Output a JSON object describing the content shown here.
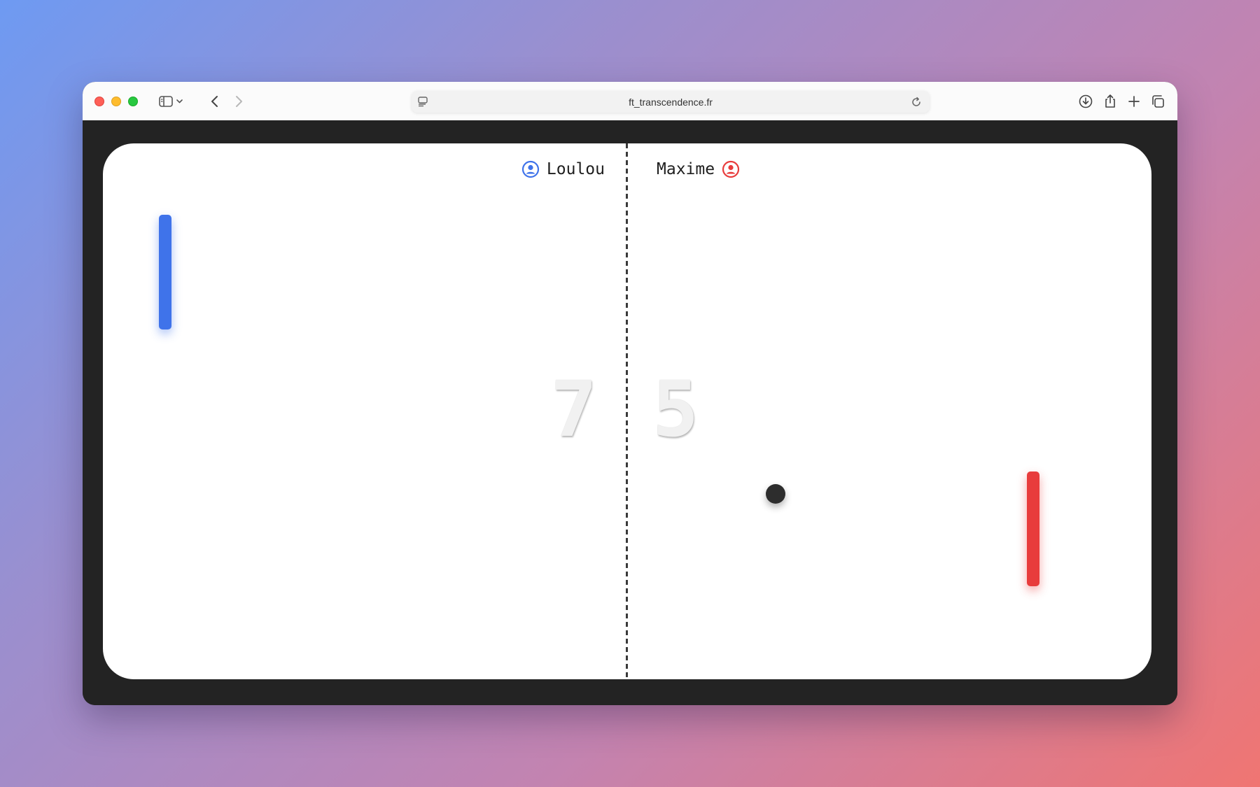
{
  "browser": {
    "url": "ft_transcendence.fr",
    "icons": {
      "sidebar": "sidebar-icon",
      "back": "chevron-left-icon",
      "forward": "chevron-right-icon",
      "reader": "reader-icon",
      "reload": "reload-icon",
      "downloads": "download-icon",
      "share": "share-icon",
      "new_tab": "plus-icon",
      "tabs": "tab-overview-icon"
    }
  },
  "game": {
    "player_left": {
      "name": "Loulou",
      "color": "#3f73ea",
      "icon": "user-circle-icon"
    },
    "player_right": {
      "name": "Maxime",
      "color": "#e83c3c",
      "icon": "user-circle-icon"
    },
    "score_left": "7",
    "score_right": "5",
    "ball_color": "#2d2d2d"
  }
}
